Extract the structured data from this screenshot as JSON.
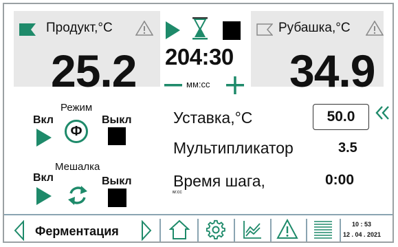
{
  "product": {
    "title": "Продукт,°С",
    "value": "25.2"
  },
  "jacket": {
    "title": "Рубашка,°С",
    "value": "34.9"
  },
  "timer": {
    "value": "204:30",
    "unit": "мм:сс"
  },
  "mode": {
    "title": "Режим",
    "on": "Вкл",
    "off": "Выкл",
    "symbol": "Ф"
  },
  "mixer": {
    "title": "Мешалка",
    "on": "Вкл",
    "off": "Выкл"
  },
  "params": {
    "setpoint_label": "Уставка,°С",
    "setpoint_value": "50.0",
    "multiplier_label": "Мультипликатор",
    "multiplier_value": "3.5",
    "step_time_label": "Время шага,",
    "step_time_unit": "м:сс",
    "step_time_value": "0:00"
  },
  "nav": {
    "current_screen": "Ферментация",
    "time": "10 : 53",
    "date": "12 . 04 . 2021"
  },
  "colors": {
    "accent": "#1e8a6a",
    "panel": "#e8e8e8",
    "frame": "#9aa0a3"
  }
}
